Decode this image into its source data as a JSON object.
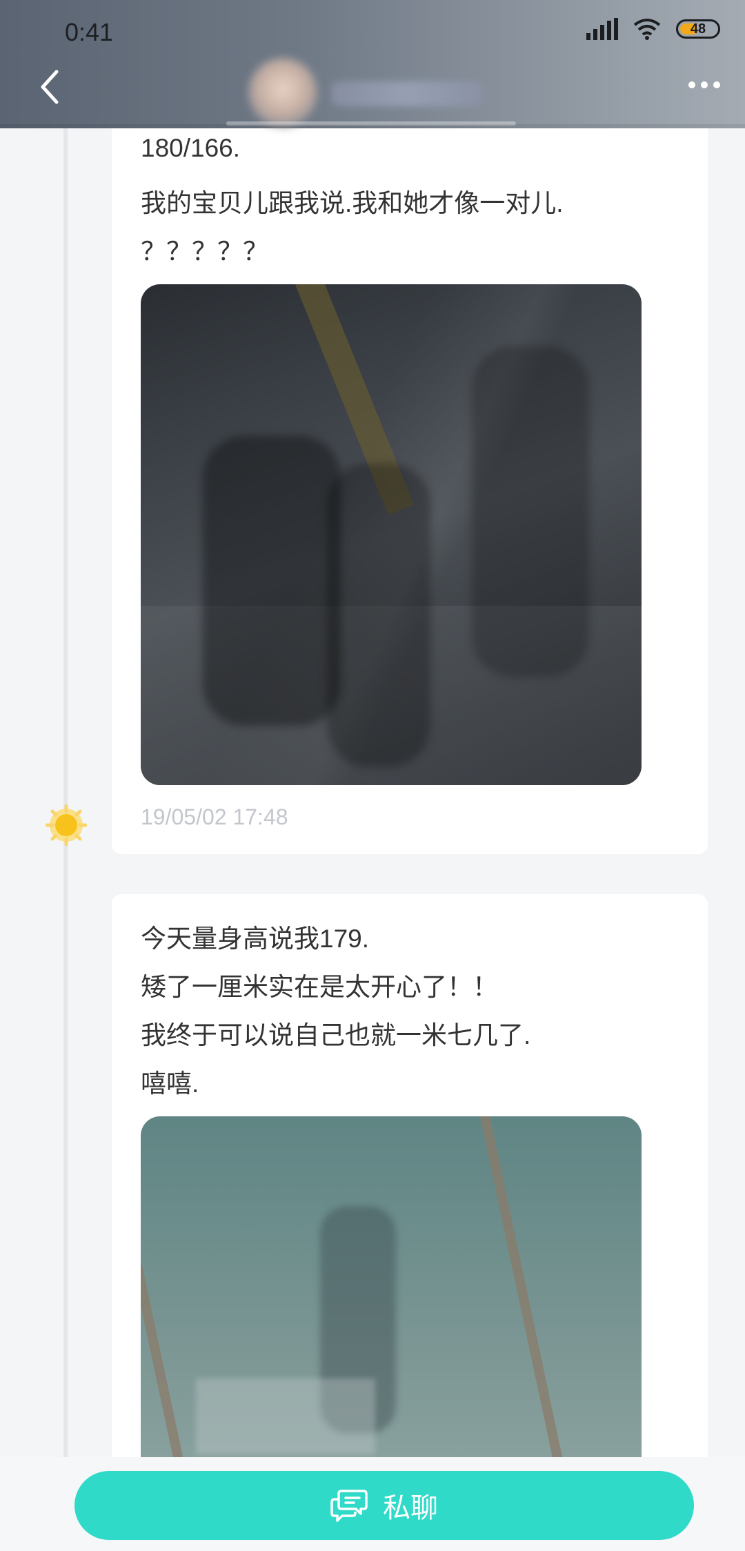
{
  "status_bar": {
    "time": "0:41",
    "battery_level": "48",
    "battery_fraction": 0.48
  },
  "header": {
    "back_icon": "chevron-left-icon",
    "more_icon": "more-horizontal-icon"
  },
  "posts": [
    {
      "lines": [
        "180/166.",
        "我的宝贝儿跟我说.我和她才像一对儿.",
        "？？？？？"
      ],
      "photo_icon": "photo",
      "timestamp": "19/05/02 17:48",
      "marker_icon": "sun-icon"
    },
    {
      "lines": [
        "今天量身高说我179.",
        "矮了一厘米实在是太开心了！！",
        "我终于可以说自己也就一米七几了.",
        "嘻嘻."
      ],
      "photo_icon": "photo"
    }
  ],
  "bottom": {
    "chat_label": "私聊",
    "chat_icon": "chat-bubbles-icon"
  },
  "colors": {
    "accent": "#2fdac9",
    "sun": "#f7c21b",
    "battery": "#f2a91b"
  }
}
